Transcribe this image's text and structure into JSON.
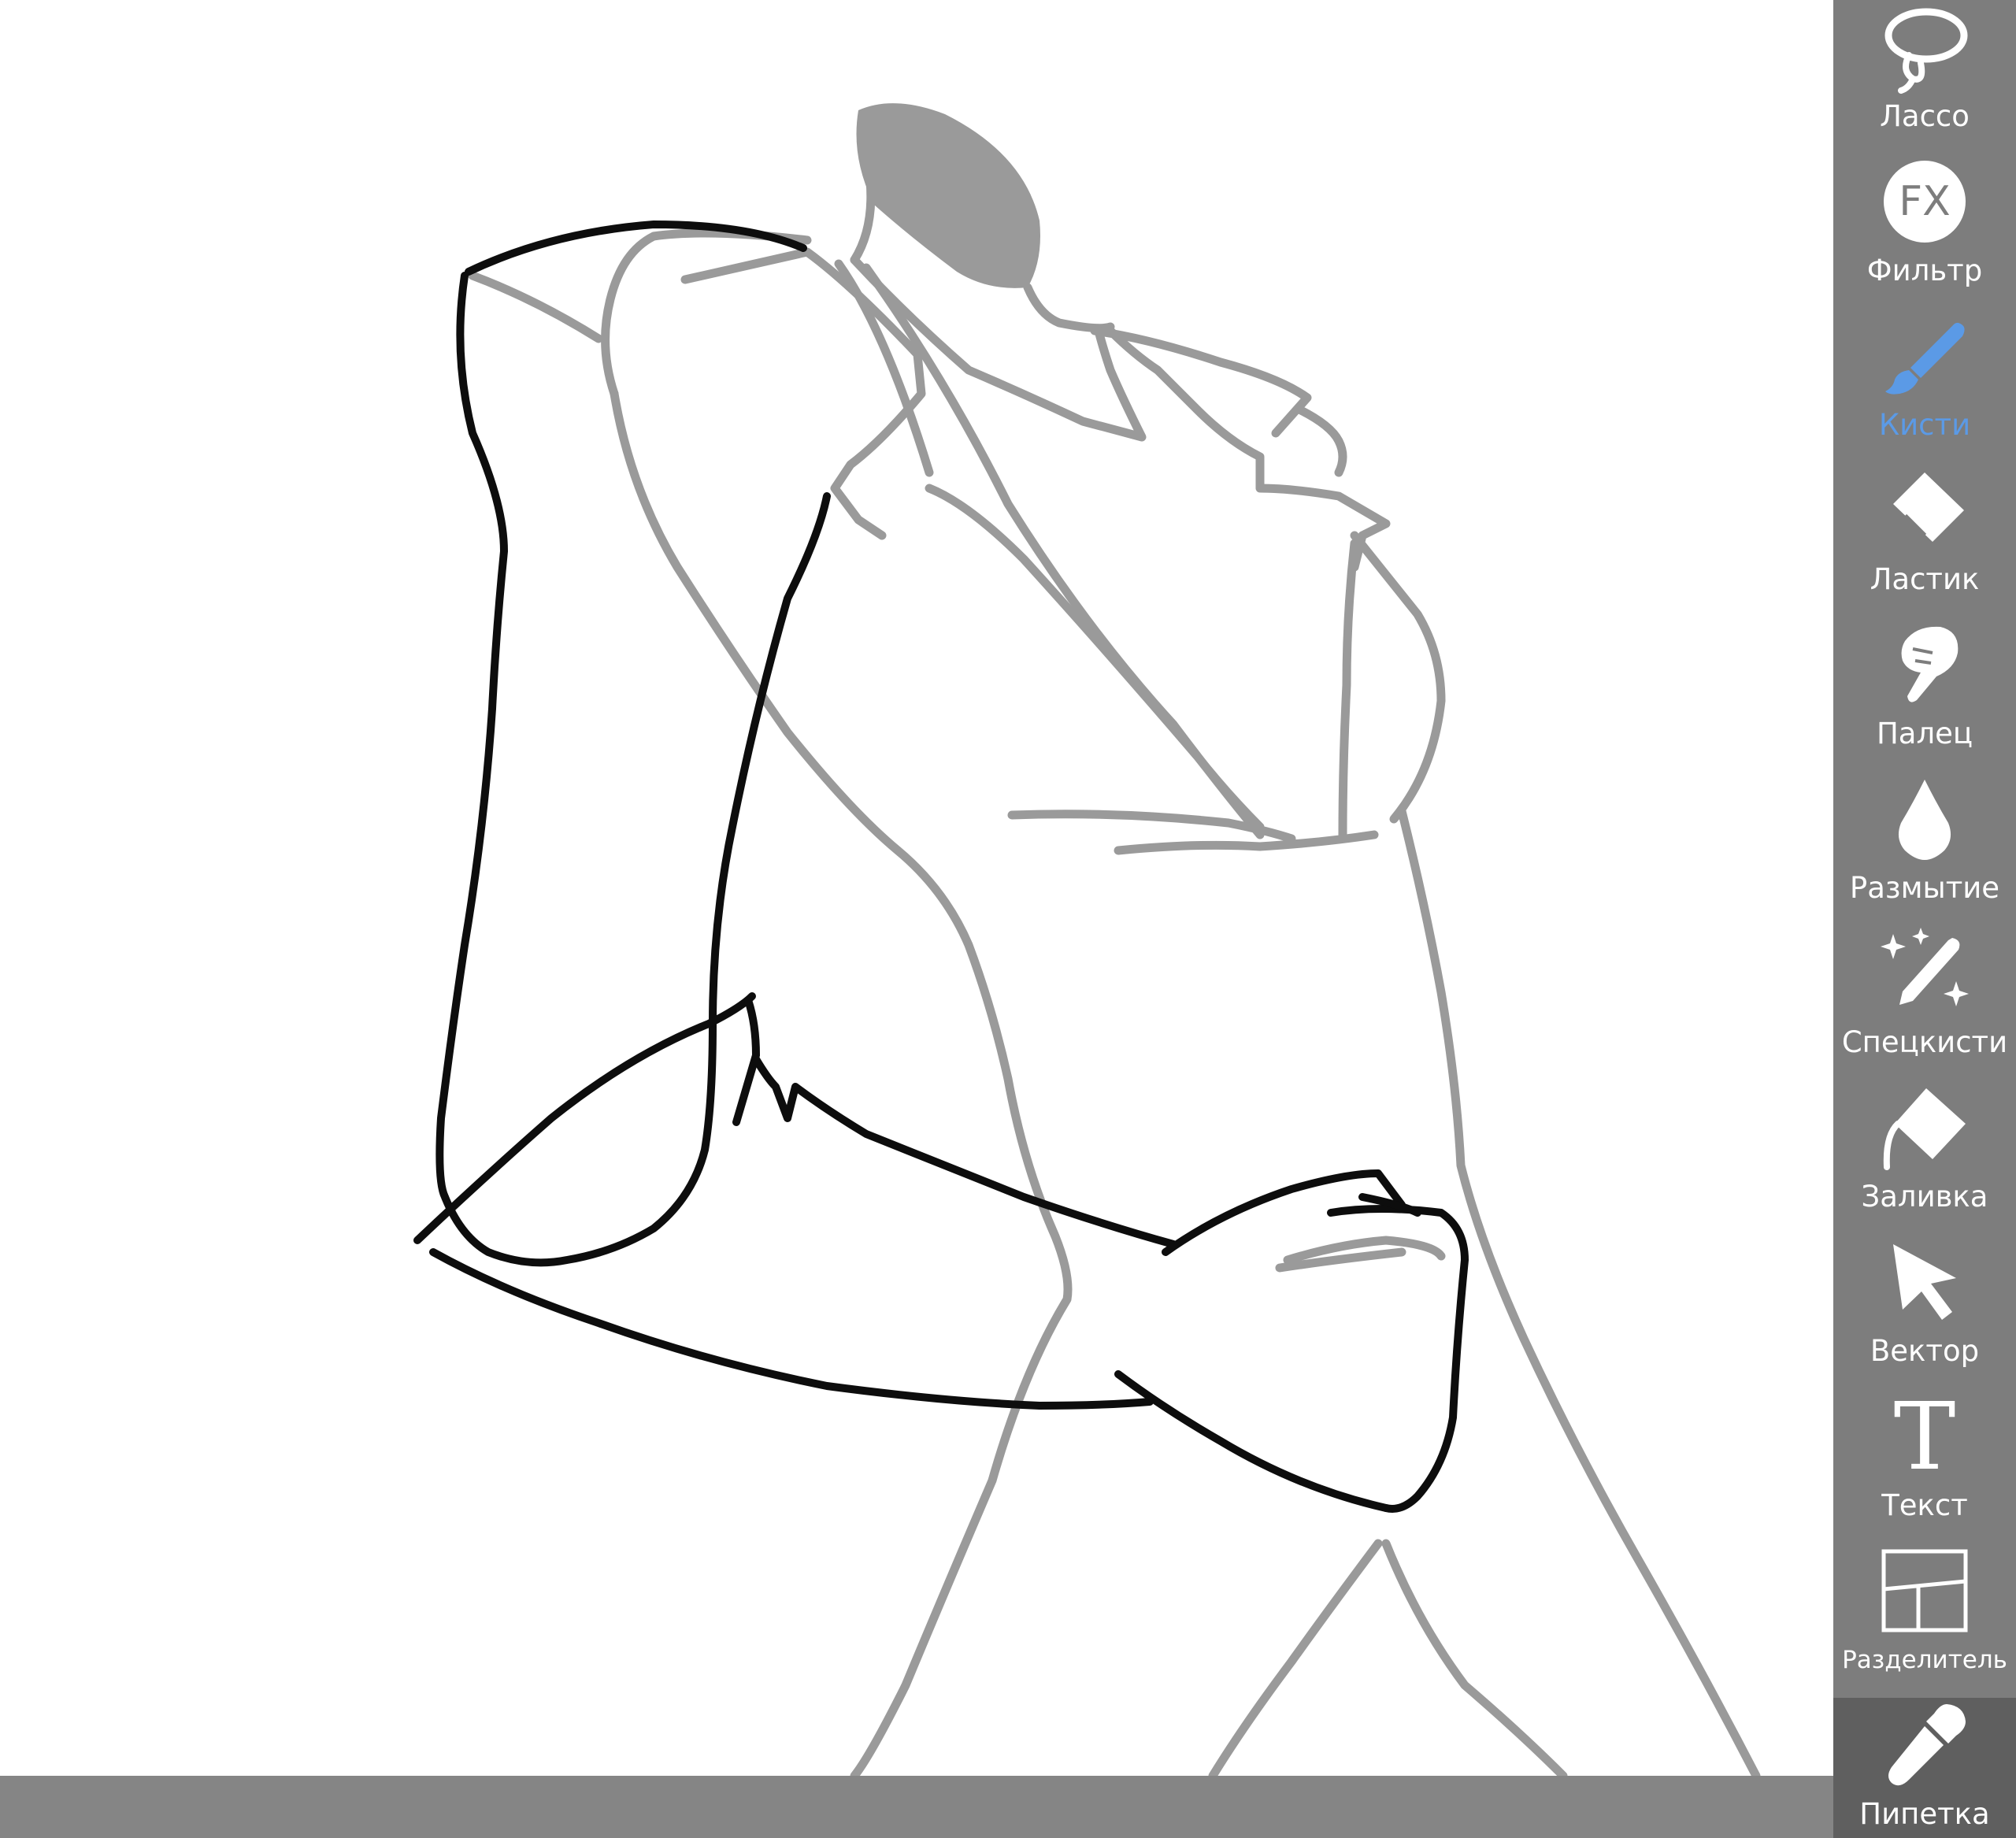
{
  "toolbar": {
    "active_tool": "Кисти",
    "active_color": "#5b9ae6",
    "tools": [
      {
        "id": "lasso",
        "label": "Лассо",
        "icon": "lasso-icon"
      },
      {
        "id": "filter",
        "label": "Фильтр",
        "icon": "fx-icon",
        "icon_text": "FX"
      },
      {
        "id": "brush",
        "label": "Кисти",
        "icon": "brush-icon"
      },
      {
        "id": "eraser",
        "label": "Ластик",
        "icon": "eraser-icon"
      },
      {
        "id": "finger",
        "label": "Палец",
        "icon": "finger-icon"
      },
      {
        "id": "blur",
        "label": "Размытие",
        "icon": "drop-icon"
      },
      {
        "id": "special-brush",
        "label": "Спецкисти",
        "icon": "magic-pen-icon"
      },
      {
        "id": "fill",
        "label": "Заливка",
        "icon": "fill-bucket-icon"
      },
      {
        "id": "vector",
        "label": "Вектор",
        "icon": "cursor-arrow-icon"
      },
      {
        "id": "text",
        "label": "Текст",
        "icon": "text-icon",
        "icon_text": "T"
      },
      {
        "id": "divider",
        "label": "Разделитель",
        "icon": "frame-divider-icon"
      },
      {
        "id": "eyedropper",
        "label": "Пипетка",
        "icon": "eyedropper-icon"
      }
    ]
  }
}
